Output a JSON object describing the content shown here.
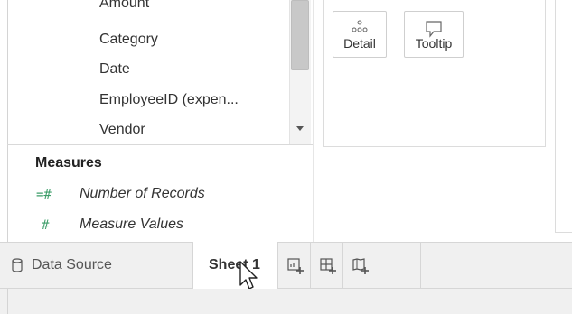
{
  "dimensions": {
    "items": [
      {
        "label": "Amount"
      },
      {
        "label": "Category"
      },
      {
        "label": "Date"
      },
      {
        "label": "EmployeeID (expen..."
      },
      {
        "label": "Vendor"
      }
    ]
  },
  "measures": {
    "title": "Measures",
    "items": [
      {
        "label": "Number of Records",
        "icon": "calc-measure-icon",
        "glyph": "=#"
      },
      {
        "label": "Measure Values",
        "icon": "measure-icon",
        "glyph": "#"
      }
    ]
  },
  "marks": {
    "detail_label": "Detail",
    "tooltip_label": "Tooltip"
  },
  "tabs": {
    "data_source_label": "Data Source",
    "sheet_label": "Sheet 1",
    "new_worksheet": "new-worksheet-icon",
    "new_dashboard": "new-dashboard-icon",
    "new_story": "new-story-icon"
  },
  "colors": {
    "measure_green": "#3e9e6a",
    "tab_bar_bg": "#f0f0f0"
  }
}
